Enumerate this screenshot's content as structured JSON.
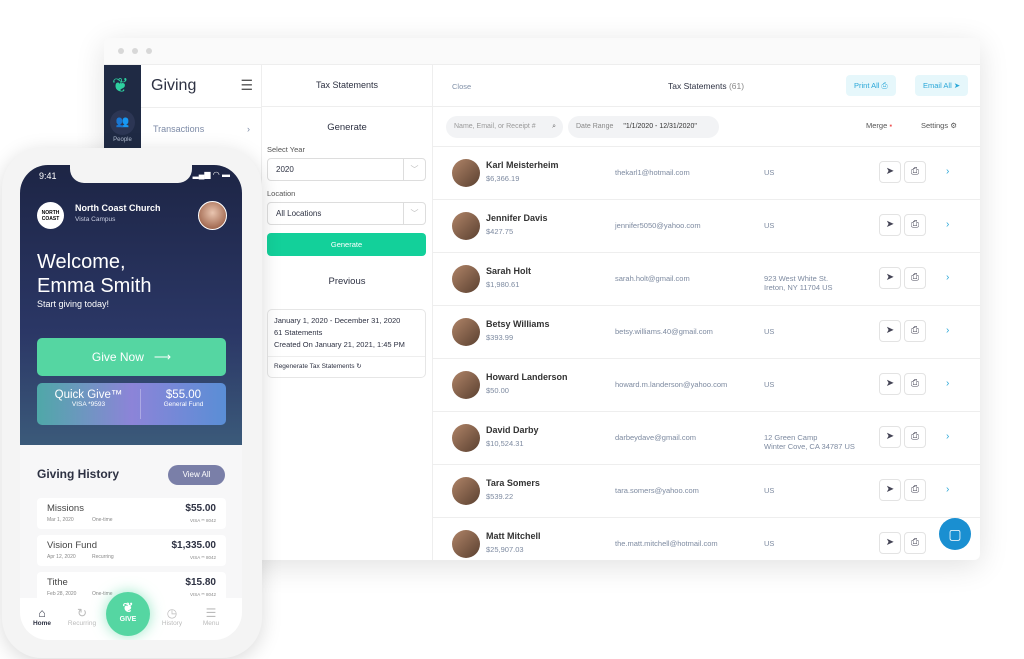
{
  "desktop": {
    "rail": {
      "people_label": "People"
    },
    "giving": {
      "title": "Giving",
      "items": [
        {
          "label": "Transactions"
        }
      ]
    },
    "tax_panel": {
      "header": "Tax Statements",
      "generate_heading": "Generate",
      "year_label": "Select Year",
      "year_value": "2020",
      "location_label": "Location",
      "location_value": "All Locations",
      "generate_button": "Generate",
      "previous_heading": "Previous",
      "previous": {
        "range": "January 1, 2020 - December 31, 2020",
        "count": "61 Statements",
        "created": "Created On January 21, 2021, 1:45 PM",
        "regenerate": "Regenerate Tax Statements"
      }
    },
    "main": {
      "close": "Close",
      "title": "Tax Statements",
      "count": "(61)",
      "print_all": "Print All",
      "email_all": "Email All",
      "search_placeholder": "Name, Email, or Receipt #",
      "date_range_label": "Date Range",
      "date_range_value": "\"1/1/2020 - 12/31/2020\"",
      "merge": "Merge",
      "settings": "Settings",
      "rows": [
        {
          "name": "Karl Meisterheim",
          "amount": "$6,366.19",
          "email": "thekarl1@hotmail.com",
          "location": "US",
          "location2": ""
        },
        {
          "name": "Jennifer Davis",
          "amount": "$427.75",
          "email": "jennifer5050@yahoo.com",
          "location": "US",
          "location2": ""
        },
        {
          "name": "Sarah Holt",
          "amount": "$1,980.61",
          "email": "sarah.holt@gmail.com",
          "location": "923 West White St.",
          "location2": "Ireton, NY 11704 US"
        },
        {
          "name": "Betsy Williams",
          "amount": "$393.99",
          "email": "betsy.williams.40@gmail.com",
          "location": "US",
          "location2": ""
        },
        {
          "name": "Howard Landerson",
          "amount": "$50.00",
          "email": "howard.m.landerson@yahoo.com",
          "location": "US",
          "location2": ""
        },
        {
          "name": "David Darby",
          "amount": "$10,524.31",
          "email": "darbeydave@gmail.com",
          "location": "12 Green Camp",
          "location2": "Winter Cove, CA 34787 US"
        },
        {
          "name": "Tara Somers",
          "amount": "$539.22",
          "email": "tara.somers@yahoo.com",
          "location": "US",
          "location2": ""
        },
        {
          "name": "Matt Mitchell",
          "amount": "$25,907.03",
          "email": "the.matt.mitchell@hotmail.com",
          "location": "US",
          "location2": ""
        }
      ]
    }
  },
  "phone": {
    "time": "9:41",
    "church": "North Coast Church",
    "campus": "Vista Campus",
    "logo_text": "NORTH COAST",
    "welcome_line1": "Welcome,",
    "welcome_line2": "Emma Smith",
    "subtitle": "Start giving today!",
    "give_now": "Give Now",
    "quick_give": "Quick Give™",
    "card": "VISA *9593",
    "quick_amount": "$55.00",
    "quick_fund": "General Fund",
    "history_title": "Giving History",
    "view_all": "View All",
    "history": [
      {
        "fund": "Missions",
        "date": "Mar 1, 2020",
        "type": "One-time",
        "amount": "$55.00",
        "card": "VISA ** 8042"
      },
      {
        "fund": "Vision Fund",
        "date": "Apr 12, 2020",
        "type": "Recurring",
        "amount": "$1,335.00",
        "card": "VISA ** 8042"
      },
      {
        "fund": "Tithe",
        "date": "Feb 28, 2020",
        "type": "One-time",
        "amount": "$15.80",
        "card": "VISA ** 8042"
      }
    ],
    "nav": {
      "home": "Home",
      "recurring": "Recurring",
      "give": "GIVE",
      "history": "History",
      "menu": "Menu"
    }
  },
  "colors": {
    "accent": "#13d09a",
    "rail": "#1f2a44",
    "link": "#2aa7d8",
    "phone_green": "#55d6a2"
  }
}
